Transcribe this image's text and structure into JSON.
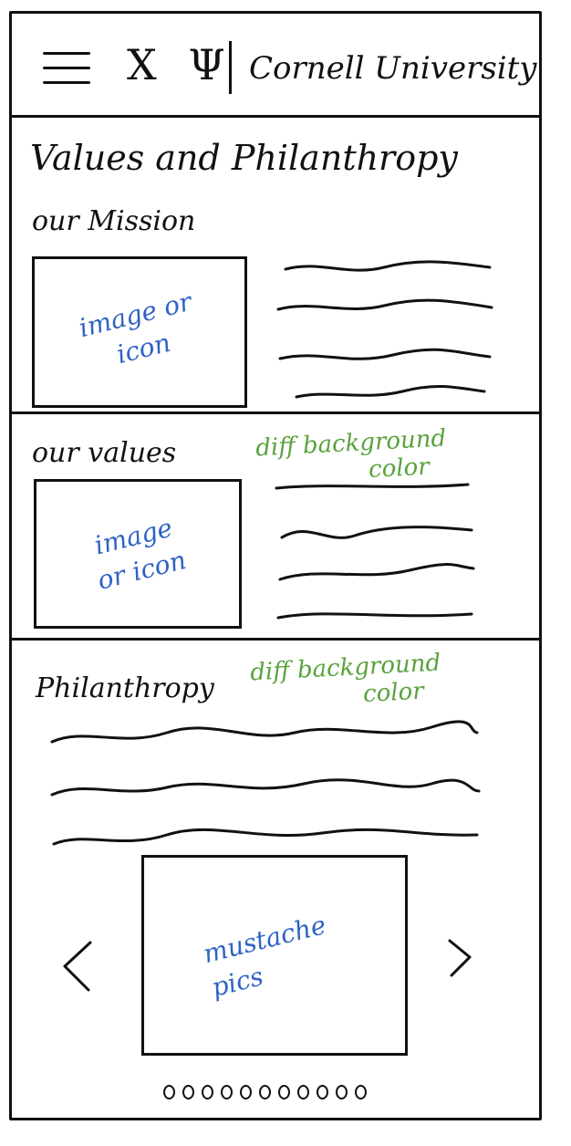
{
  "header": {
    "logo_letters": "X Ψ",
    "brand": "Cornell University"
  },
  "page": {
    "title": "Values and Philanthropy"
  },
  "mission": {
    "heading": "our Mission",
    "image_note": "image or icon"
  },
  "values": {
    "heading": "our values",
    "image_note": "image or icon",
    "bg_note_line1": "diff background",
    "bg_note_line2": "color"
  },
  "philanthropy": {
    "heading": "Philanthropy",
    "bg_note_line1": "diff background",
    "bg_note_line2": "color"
  },
  "carousel": {
    "image_note": "mustache pics",
    "dot_count": 11
  },
  "colors": {
    "ink": "#111111",
    "annotation_blue": "#2f63c4",
    "annotation_green": "#5aa23c"
  },
  "icons": {
    "menu": "hamburger-icon",
    "prev": "chevron-left-icon",
    "next": "chevron-right-icon"
  }
}
